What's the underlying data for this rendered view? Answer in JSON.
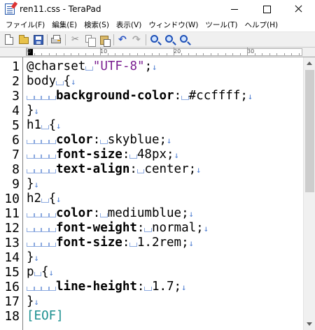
{
  "window": {
    "title": "ren11.css - TeraPad",
    "icon": "terapad-app-icon",
    "controls": [
      "minimize-icon",
      "maximize-icon",
      "close-icon"
    ]
  },
  "menu": [
    {
      "label": "ファイル(F)"
    },
    {
      "label": "編集(E)"
    },
    {
      "label": "検索(S)"
    },
    {
      "label": "表示(V)"
    },
    {
      "label": "ウィンドウ(W)"
    },
    {
      "label": "ツール(T)"
    },
    {
      "label": "ヘルプ(H)"
    }
  ],
  "toolbar": {
    "buttons": [
      "new-file-icon",
      "open-folder-icon",
      "save-icon",
      "print-icon",
      "cut-icon",
      "copy-icon",
      "paste-icon",
      "undo-icon",
      "redo-icon",
      "find-icon",
      "find-previous-icon",
      "find-next-icon"
    ]
  },
  "ruler": {
    "labels": [
      "0",
      "10",
      "20",
      "30"
    ]
  },
  "editor": {
    "line_numbers": [
      "1",
      "2",
      "3",
      "4",
      "5",
      "6",
      "7",
      "8",
      "9",
      "10",
      "11",
      "12",
      "13",
      "14",
      "15",
      "16",
      "17",
      "18"
    ],
    "lines": [
      {
        "indent": 0,
        "segments": [
          {
            "t": "@charset"
          },
          {
            "sp": 1
          },
          {
            "t": "\"UTF-8\"",
            "k": "str"
          },
          {
            "t": ";"
          }
        ],
        "eol": true
      },
      {
        "indent": 0,
        "segments": [
          {
            "t": "body"
          },
          {
            "sp": 1
          },
          {
            "t": "{"
          }
        ],
        "eol": true
      },
      {
        "indent": 4,
        "segments": [
          {
            "t": "background-color",
            "k": "kw"
          },
          {
            "t": ":"
          },
          {
            "sp": 1
          },
          {
            "t": "#ccffff;"
          }
        ],
        "eol": true
      },
      {
        "indent": 0,
        "segments": [
          {
            "t": "}"
          }
        ],
        "eol": true
      },
      {
        "indent": 0,
        "segments": [
          {
            "t": "h1"
          },
          {
            "sp": 1
          },
          {
            "t": "{"
          }
        ],
        "eol": true
      },
      {
        "indent": 4,
        "segments": [
          {
            "t": "color",
            "k": "kw"
          },
          {
            "t": ":"
          },
          {
            "sp": 1
          },
          {
            "t": "skyblue;"
          }
        ],
        "eol": true
      },
      {
        "indent": 4,
        "segments": [
          {
            "t": "font-size",
            "k": "kw"
          },
          {
            "t": ":"
          },
          {
            "sp": 1
          },
          {
            "t": "48px;"
          }
        ],
        "eol": true
      },
      {
        "indent": 4,
        "segments": [
          {
            "t": "text-align",
            "k": "kw"
          },
          {
            "t": ":"
          },
          {
            "sp": 1
          },
          {
            "t": "center;"
          }
        ],
        "eol": true
      },
      {
        "indent": 0,
        "segments": [
          {
            "t": "}"
          }
        ],
        "eol": true
      },
      {
        "indent": 0,
        "segments": [
          {
            "t": "h2"
          },
          {
            "sp": 1
          },
          {
            "t": "{"
          }
        ],
        "eol": true
      },
      {
        "indent": 4,
        "segments": [
          {
            "t": "color",
            "k": "kw"
          },
          {
            "t": ":"
          },
          {
            "sp": 1
          },
          {
            "t": "mediumblue;"
          }
        ],
        "eol": true
      },
      {
        "indent": 4,
        "segments": [
          {
            "t": "font-weight",
            "k": "kw"
          },
          {
            "t": ":"
          },
          {
            "sp": 1
          },
          {
            "t": "normal;"
          }
        ],
        "eol": true
      },
      {
        "indent": 4,
        "segments": [
          {
            "t": "font-size",
            "k": "kw"
          },
          {
            "t": ":"
          },
          {
            "sp": 1
          },
          {
            "t": "1.2rem;"
          }
        ],
        "eol": true
      },
      {
        "indent": 0,
        "segments": [
          {
            "t": "}"
          }
        ],
        "eol": true
      },
      {
        "indent": 0,
        "segments": [
          {
            "t": "p"
          },
          {
            "sp": 1
          },
          {
            "t": "{"
          }
        ],
        "eol": true
      },
      {
        "indent": 4,
        "segments": [
          {
            "t": "line-height",
            "k": "kw"
          },
          {
            "t": ":"
          },
          {
            "sp": 1
          },
          {
            "t": "1.7;"
          }
        ],
        "eol": true
      },
      {
        "indent": 0,
        "segments": [
          {
            "t": "}"
          }
        ],
        "eol": true
      },
      {
        "indent": 0,
        "segments": [
          {
            "t": "[EOF]",
            "k": "eof"
          }
        ],
        "eol": false
      }
    ],
    "eol_mark": "↓",
    "colors": {
      "keyword": "#000000",
      "string": "#7a1f90",
      "eof": "#1a8f8f",
      "whitespace_mark": "#4a7bd0"
    }
  }
}
